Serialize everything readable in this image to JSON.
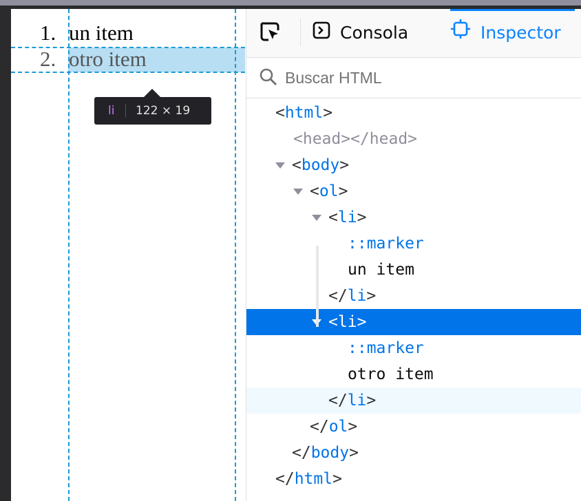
{
  "page": {
    "items": [
      {
        "number": "1.",
        "text": "un item"
      },
      {
        "number": "2.",
        "text": "otro item"
      }
    ]
  },
  "tooltip": {
    "tag": "li",
    "dimensions": "122 × 19"
  },
  "devtools": {
    "tabs": {
      "console": "Consola",
      "inspector": "Inspector"
    },
    "search": {
      "placeholder": "Buscar HTML"
    },
    "tree": {
      "html_open": "html",
      "head": "<head></head>",
      "body_open": "body",
      "ol_open": "ol",
      "li1_open": "li",
      "marker1": "::marker",
      "text1": "un item",
      "li1_close": "li",
      "li2_open": "li",
      "marker2": "::marker",
      "text2": "otro item",
      "li2_close": "li",
      "ol_close": "ol",
      "body_close": "body",
      "html_close": "html"
    }
  },
  "colors": {
    "accent": "#0074e8",
    "highlight": "#b7def3",
    "guide": "#1a9ad6"
  }
}
